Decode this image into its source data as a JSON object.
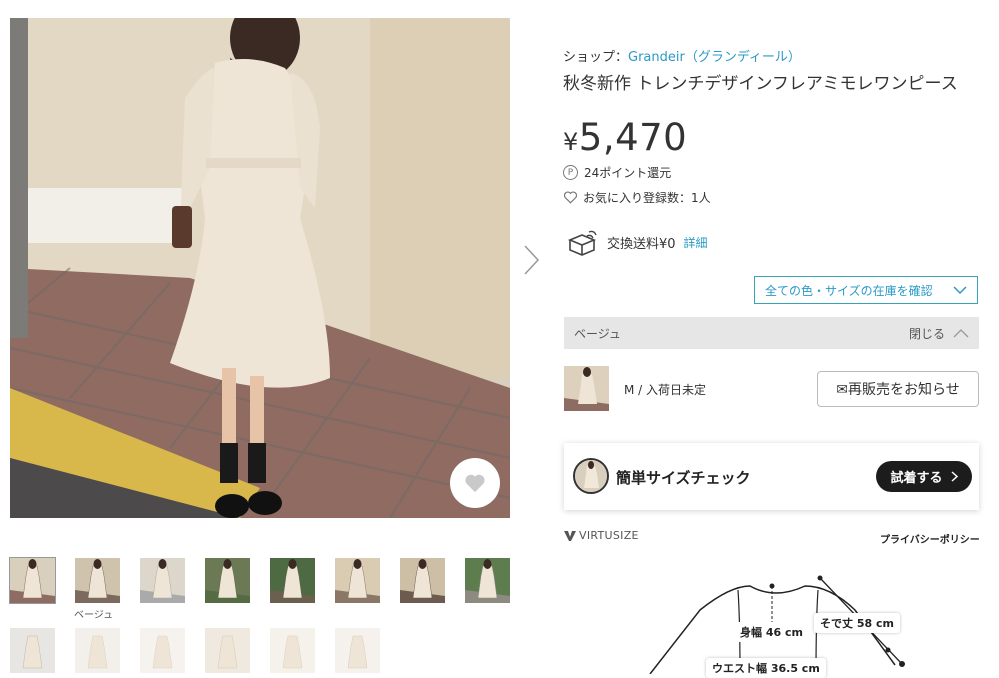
{
  "product": {
    "shop_prefix": "ショップ：",
    "shop_name": "Grandeir（グランディール）",
    "title": "秋冬新作 トレンチデザインフレアミモレワンピース",
    "price_yen": "¥",
    "price_value": "5,470",
    "points_icon": "P",
    "points_text": "24ポイント還元",
    "favorites_text": "お気に入り登録数：1人",
    "exchange_text": "交換送料¥0",
    "exchange_detail": "詳細",
    "stock_button": "全ての色・サイズの在庫を確認"
  },
  "color_section": {
    "color_name": "ベージュ",
    "close_label": "閉じる",
    "variant_text": "M / 入荷日未定",
    "notify_button": "✉再販売をお知らせ"
  },
  "size_check": {
    "label": "簡単サイズチェック",
    "try_button": "試着する",
    "brand": "VIRTUSIZE",
    "privacy": "プライバシーポリシー",
    "measurements": {
      "body_width": "身幅 46 cm",
      "sleeve": "そで丈 58 cm",
      "waist": "ウエスト幅 36.5 cm"
    }
  },
  "gallery": {
    "thumb_caption": "ベージュ",
    "thumb_count": 14
  },
  "colors": {
    "link": "#2a9ac6",
    "accent_border": "#39a3b5",
    "dress": "#efe5d6",
    "wall": "#e2d7c3"
  }
}
